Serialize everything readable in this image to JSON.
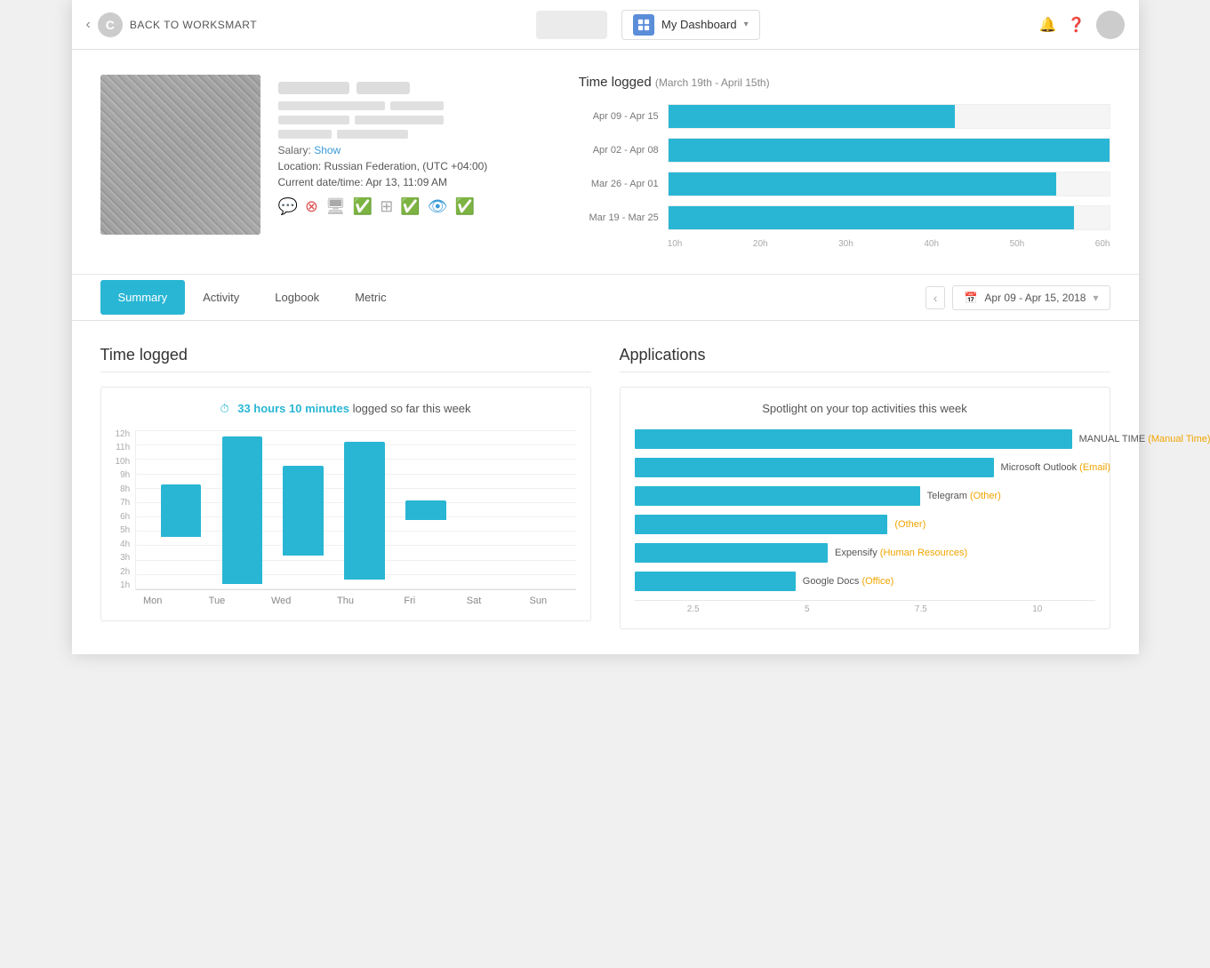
{
  "header": {
    "back_label": "BACK TO WORKSMART",
    "logo_letter": "C",
    "dashboard_label": "My Dashboard",
    "notification_icon": "🔔",
    "help_icon": "❓"
  },
  "profile": {
    "salary_label": "Salary:",
    "salary_show": "Show",
    "location_label": "Location: Russian Federation, (UTC +04:00)",
    "datetime_label": "Current date/time: Apr 13, 11:09 AM"
  },
  "time_logged_header": {
    "title": "Time logged",
    "subtitle": "(March 19th - April 15th)",
    "bars": [
      {
        "label": "Apr 09 - Apr 15",
        "pct": 65
      },
      {
        "label": "Apr 02 - Apr 08",
        "pct": 100
      },
      {
        "label": "Mar 26 - Apr 01",
        "pct": 88
      },
      {
        "label": "Mar 19 - Mar 25",
        "pct": 92
      }
    ],
    "axis_labels": [
      "10h",
      "20h",
      "30h",
      "40h",
      "50h",
      "60h"
    ]
  },
  "tabs": {
    "items": [
      "Summary",
      "Activity",
      "Logbook",
      "Metric"
    ],
    "active_index": 0,
    "date_range": "Apr 09 - Apr 15, 2018"
  },
  "time_logged_bottom": {
    "section_title": "Time logged",
    "card_summary": "33 hours 10 minutes",
    "card_suffix": " logged so far this week",
    "y_labels": [
      "12h",
      "11h",
      "10h",
      "9h",
      "8h",
      "7h",
      "6h",
      "5h",
      "4h",
      "3h",
      "2h",
      "1h"
    ],
    "days": [
      {
        "label": "Mon",
        "height_pct": 33,
        "empty": false
      },
      {
        "label": "Tue",
        "height_pct": 92,
        "empty": false
      },
      {
        "label": "Wed",
        "height_pct": 56,
        "empty": false
      },
      {
        "label": "Thu",
        "height_pct": 86,
        "empty": false
      },
      {
        "label": "Fri",
        "height_pct": 12,
        "empty": false
      },
      {
        "label": "Sat",
        "height_pct": 0,
        "empty": true
      },
      {
        "label": "Sun",
        "height_pct": 0,
        "empty": true
      }
    ]
  },
  "applications": {
    "section_title": "Applications",
    "card_title": "Spotlight on your top activities this week",
    "items": [
      {
        "name": "MANUAL TIME",
        "category": "Manual Time",
        "width_pct": 95
      },
      {
        "name": "Microsoft Outlook",
        "category": "Email",
        "width_pct": 78
      },
      {
        "name": "Telegram",
        "category": "Other",
        "width_pct": 62
      },
      {
        "name": "",
        "category": "Other",
        "width_pct": 55
      },
      {
        "name": "Expensify",
        "category": "Human Resources",
        "width_pct": 42
      },
      {
        "name": "Google Docs",
        "category": "Office",
        "width_pct": 35
      }
    ],
    "axis_labels": [
      "2.5",
      "5",
      "7.5",
      "10"
    ]
  }
}
